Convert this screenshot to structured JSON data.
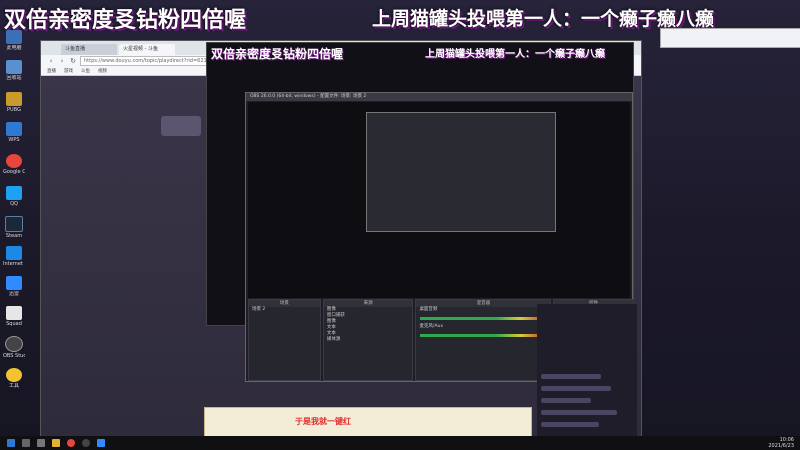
{
  "overlay": {
    "title_left": "双倍亲密度㕛钻粉四倍喔",
    "title_right": "上周猫罐头投喂第一人：一个癞子癞八癞"
  },
  "desktop_icons": [
    {
      "label": "Google Chrome",
      "icon": "chrome-icon",
      "color": "#e8453c"
    },
    {
      "label": "Steam",
      "icon": "steam-icon",
      "color": "#1b2838"
    },
    {
      "label": "OBS Studio",
      "icon": "obs-icon",
      "color": "#444444"
    },
    {
      "label": "Internet Explorer",
      "icon": "ie-icon",
      "color": "#1e88e5"
    }
  ],
  "browser": {
    "tabs": [
      "斗鱼直播",
      "火星视频 - 斗鱼"
    ],
    "url": "https://www.douyu.com/topic/playdirect?rid=6217391",
    "bookmarks": [
      "直播",
      "游戏",
      "斗鱼",
      "视频"
    ]
  },
  "obs": {
    "title": "OBS 26.0.0 (64-bit, windows) - 配置文件: 场景: 场景 2",
    "panels": {
      "scenes": {
        "header": "场景",
        "items": [
          "场景 2"
        ]
      },
      "sources": {
        "header": "来源",
        "items": [
          "图像",
          "窗口捕获",
          "图像",
          "文本",
          "文本",
          "媒体源"
        ]
      },
      "mixer": {
        "header": "混音器",
        "items": [
          "桌面音频",
          "麦克风/Aux"
        ]
      },
      "controls": {
        "header": "控件",
        "items": [
          "停止推流",
          "开始录制",
          "启动虚拟摄像机",
          "工作室模式",
          "设置",
          "退出"
        ]
      }
    }
  },
  "gift_bar": {
    "text": "于是我就一键红"
  },
  "taskbar": {
    "time": "10:06",
    "date": "2021/6/23",
    "language": "英"
  }
}
